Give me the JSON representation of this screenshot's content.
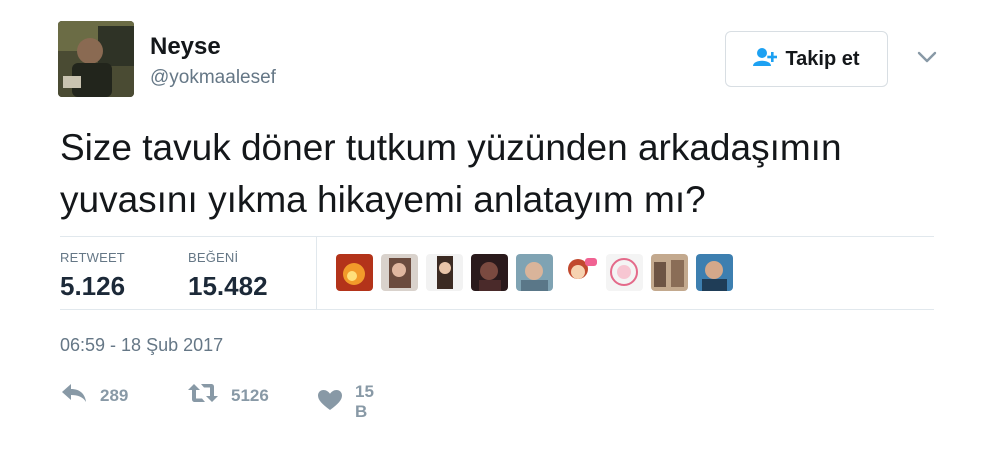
{
  "user": {
    "name": "Neyse",
    "handle": "@yokmaalesef"
  },
  "follow_button": {
    "label": "Takip et"
  },
  "tweet": {
    "line1": "Size tavuk döner tutkum yüzünden arkadaşımın",
    "line2": "yuvasını yıkma hikayemi anlatayım mı?"
  },
  "stats": {
    "retweet_label": "RETWEET",
    "retweet_value": "5.126",
    "like_label": "BEĞENİ",
    "like_value": "15.482"
  },
  "timestamp": "06:59 - 18 Şub 2017",
  "actions": {
    "reply_count": "289",
    "retweet_count": "5126",
    "like_count": "15 B"
  },
  "colors": {
    "text": "#14171a",
    "muted": "#657786",
    "action_gray": "#8899a6",
    "follow_icon": "#1da1f2",
    "divider": "#e1e8ed"
  },
  "icons": {
    "follow": "add-user-icon",
    "menu": "chevron-down-icon",
    "reply": "reply-icon",
    "retweet": "retweet-icon",
    "like": "heart-icon"
  }
}
